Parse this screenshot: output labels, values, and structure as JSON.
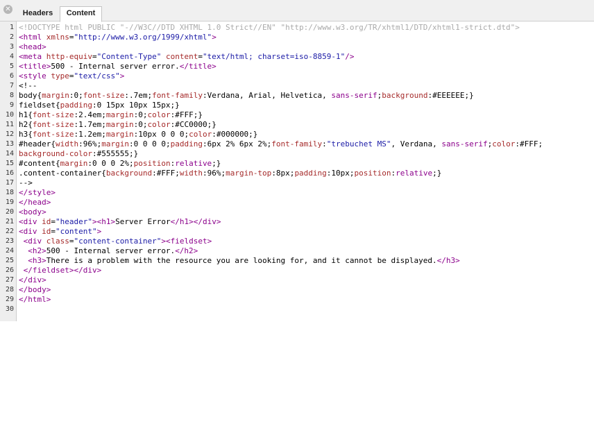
{
  "tabs": [
    {
      "label": "Headers",
      "active": false
    },
    {
      "label": "Content",
      "active": true
    }
  ],
  "close_icon": "close-icon",
  "colors": {
    "comment": "#aaaaaa",
    "tag": "#8b008b",
    "attr": "#a52a2a",
    "value": "#1a1aa6",
    "text": "#000000",
    "gutter_bg": "#eeeeee"
  },
  "code_lines": [
    [
      [
        "c",
        "<!DOCTYPE html PUBLIC \"-//W3C//DTD XHTML 1.0 Strict//EN\" \"http://www.w3.org/TR/xhtml1/DTD/xhtml1-strict.dtd\">"
      ]
    ],
    [
      [
        "g",
        "<html "
      ],
      [
        "a",
        "xmlns"
      ],
      [
        "t",
        "="
      ],
      [
        "v",
        "\"http://www.w3.org/1999/xhtml\""
      ],
      [
        "g",
        ">"
      ]
    ],
    [
      [
        "g",
        "<head>"
      ]
    ],
    [
      [
        "g",
        "<meta "
      ],
      [
        "a",
        "http-equiv"
      ],
      [
        "t",
        "="
      ],
      [
        "v",
        "\"Content-Type\""
      ],
      [
        "t",
        " "
      ],
      [
        "a",
        "content"
      ],
      [
        "t",
        "="
      ],
      [
        "v",
        "\"text/html; charset=iso-8859-1\""
      ],
      [
        "g",
        "/>"
      ]
    ],
    [
      [
        "g",
        "<title>"
      ],
      [
        "t",
        "500 - Internal server error."
      ],
      [
        "g",
        "</title>"
      ]
    ],
    [
      [
        "g",
        "<style "
      ],
      [
        "a",
        "type"
      ],
      [
        "t",
        "="
      ],
      [
        "v",
        "\"text/css\""
      ],
      [
        "g",
        ">"
      ]
    ],
    [
      [
        "t",
        "<!--"
      ]
    ],
    [
      [
        "t",
        "body{"
      ],
      [
        "a",
        "margin"
      ],
      [
        "t",
        ":0;"
      ],
      [
        "a",
        "font-size"
      ],
      [
        "t",
        ":.7em;"
      ],
      [
        "a",
        "font-family"
      ],
      [
        "t",
        ":Verdana, Arial, Helvetica, "
      ],
      [
        "g",
        "sans-serif"
      ],
      [
        "t",
        ";"
      ],
      [
        "a",
        "background"
      ],
      [
        "t",
        ":#EEEEEE;}"
      ]
    ],
    [
      [
        "t",
        "fieldset{"
      ],
      [
        "a",
        "padding"
      ],
      [
        "t",
        ":0 15px 10px 15px;}"
      ]
    ],
    [
      [
        "t",
        "h1{"
      ],
      [
        "a",
        "font-size"
      ],
      [
        "t",
        ":2.4em;"
      ],
      [
        "a",
        "margin"
      ],
      [
        "t",
        ":0;"
      ],
      [
        "a",
        "color"
      ],
      [
        "t",
        ":#FFF;}"
      ]
    ],
    [
      [
        "t",
        "h2{"
      ],
      [
        "a",
        "font-size"
      ],
      [
        "t",
        ":1.7em;"
      ],
      [
        "a",
        "margin"
      ],
      [
        "t",
        ":0;"
      ],
      [
        "a",
        "color"
      ],
      [
        "t",
        ":#CC0000;}"
      ]
    ],
    [
      [
        "t",
        "h3{"
      ],
      [
        "a",
        "font-size"
      ],
      [
        "t",
        ":1.2em;"
      ],
      [
        "a",
        "margin"
      ],
      [
        "t",
        ":10px 0 0 0;"
      ],
      [
        "a",
        "color"
      ],
      [
        "t",
        ":#000000;}"
      ]
    ],
    [
      [
        "t",
        "#header{"
      ],
      [
        "a",
        "width"
      ],
      [
        "t",
        ":96%;"
      ],
      [
        "a",
        "margin"
      ],
      [
        "t",
        ":0 0 0 0;"
      ],
      [
        "a",
        "padding"
      ],
      [
        "t",
        ":6px 2% 6px 2%;"
      ],
      [
        "a",
        "font-family"
      ],
      [
        "t",
        ":"
      ],
      [
        "v",
        "\"trebuchet MS\""
      ],
      [
        "t",
        ", Verdana, "
      ],
      [
        "g",
        "sans-serif"
      ],
      [
        "t",
        ";"
      ],
      [
        "a",
        "color"
      ],
      [
        "t",
        ":#FFF;"
      ]
    ],
    [
      [
        "a",
        "background-color"
      ],
      [
        "t",
        ":#555555;}"
      ]
    ],
    [
      [
        "t",
        "#content{"
      ],
      [
        "a",
        "margin"
      ],
      [
        "t",
        ":0 0 0 2%;"
      ],
      [
        "a",
        "position"
      ],
      [
        "t",
        ":"
      ],
      [
        "g",
        "relative"
      ],
      [
        "t",
        ";}"
      ]
    ],
    [
      [
        "t",
        ".content-container{"
      ],
      [
        "a",
        "background"
      ],
      [
        "t",
        ":#FFF;"
      ],
      [
        "a",
        "width"
      ],
      [
        "t",
        ":96%;"
      ],
      [
        "a",
        "margin-top"
      ],
      [
        "t",
        ":8px;"
      ],
      [
        "a",
        "padding"
      ],
      [
        "t",
        ":10px;"
      ],
      [
        "a",
        "position"
      ],
      [
        "t",
        ":"
      ],
      [
        "g",
        "relative"
      ],
      [
        "t",
        ";}"
      ]
    ],
    [
      [
        "t",
        "-->"
      ]
    ],
    [
      [
        "g",
        "</style>"
      ]
    ],
    [
      [
        "g",
        "</head>"
      ]
    ],
    [
      [
        "g",
        "<body>"
      ]
    ],
    [
      [
        "g",
        "<div "
      ],
      [
        "a",
        "id"
      ],
      [
        "t",
        "="
      ],
      [
        "v",
        "\"header\""
      ],
      [
        "g",
        "><h1>"
      ],
      [
        "t",
        "Server Error"
      ],
      [
        "g",
        "</h1></div>"
      ]
    ],
    [
      [
        "g",
        "<div "
      ],
      [
        "a",
        "id"
      ],
      [
        "t",
        "="
      ],
      [
        "v",
        "\"content\""
      ],
      [
        "g",
        ">"
      ]
    ],
    [
      [
        "t",
        " "
      ],
      [
        "g",
        "<div "
      ],
      [
        "a",
        "class"
      ],
      [
        "t",
        "="
      ],
      [
        "v",
        "\"content-container\""
      ],
      [
        "g",
        "><fieldset>"
      ]
    ],
    [
      [
        "t",
        "  "
      ],
      [
        "g",
        "<h2>"
      ],
      [
        "t",
        "500 - Internal server error."
      ],
      [
        "g",
        "</h2>"
      ]
    ],
    [
      [
        "t",
        "  "
      ],
      [
        "g",
        "<h3>"
      ],
      [
        "t",
        "There is a problem with the resource you are looking for, and it cannot be displayed."
      ],
      [
        "g",
        "</h3>"
      ]
    ],
    [
      [
        "t",
        " "
      ],
      [
        "g",
        "</fieldset></div>"
      ]
    ],
    [
      [
        "g",
        "</div>"
      ]
    ],
    [
      [
        "g",
        "</body>"
      ]
    ],
    [
      [
        "g",
        "</html>"
      ]
    ],
    []
  ]
}
